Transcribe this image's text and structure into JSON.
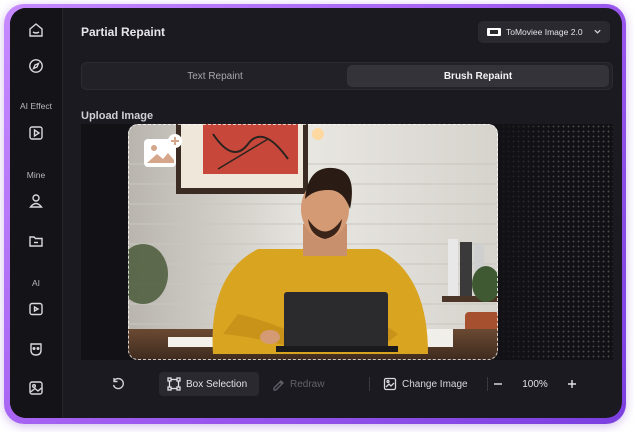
{
  "sidebar": {
    "sections": [
      {
        "label": "AI Effect"
      },
      {
        "label": "Mine"
      },
      {
        "label": "AI"
      }
    ],
    "icons": [
      "home-icon",
      "explore-icon",
      "ai-effect-icon",
      "profile-icon",
      "folder-icon",
      "ai-video-icon",
      "ai-face-icon",
      "ai-image-icon"
    ]
  },
  "header": {
    "title": "Partial Repaint",
    "model_select": "ToMoviee Image 2.0"
  },
  "tabs": [
    {
      "label": "Text Repaint",
      "active": false
    },
    {
      "label": "Brush Repaint",
      "active": true
    }
  ],
  "upload": {
    "label": "Upload Image"
  },
  "toolbar": {
    "box_selection": "Box Selection",
    "redraw": "Redraw",
    "change_image": "Change Image",
    "zoom": "100%"
  },
  "colors": {
    "frame_accent": "#a05cf0",
    "background": "#1b1a20",
    "active_tab": "#34333a"
  }
}
